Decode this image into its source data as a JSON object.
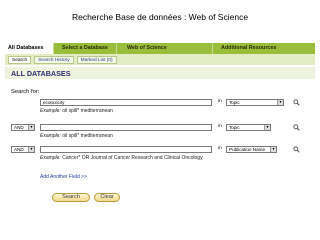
{
  "slide_title": "Recherche Base de données : Web of Science",
  "tabs": {
    "all_databases": "All Databases",
    "select_database": "Select a Database",
    "web_of_science": "Web of Science",
    "additional_resources": "Additional Resources"
  },
  "subtabs": {
    "search": "Search",
    "search_history": "Search History",
    "marked_list": "Marked List (0)"
  },
  "section_title": "ALL DATABASES",
  "search_for_label": "Search for:",
  "rows": [
    {
      "operator": "",
      "term": "ecotoxicity",
      "in_label": "in",
      "field": "Topic",
      "example_label": "Example:",
      "example_text": "oil spill* mediterranean"
    },
    {
      "operator": "AND",
      "term": "",
      "in_label": "in",
      "field": "Topic",
      "example_label": "Example:",
      "example_text": "oil spill* mediterranean"
    },
    {
      "operator": "AND",
      "term": "",
      "in_label": "in",
      "field": "Publication Name",
      "example_label": "Example:",
      "example_text": "Cancer* OR Journal of Cancer Research and Clinical Oncology"
    }
  ],
  "add_field_link": "Add Another Field >>",
  "buttons": {
    "search": "Search",
    "clear": "Clear"
  },
  "colors": {
    "tab_green": "#9abd3c",
    "subbar_bg": "#e3ecc4",
    "title_blue": "#2f2f77",
    "link_blue": "#1e3c9a"
  }
}
